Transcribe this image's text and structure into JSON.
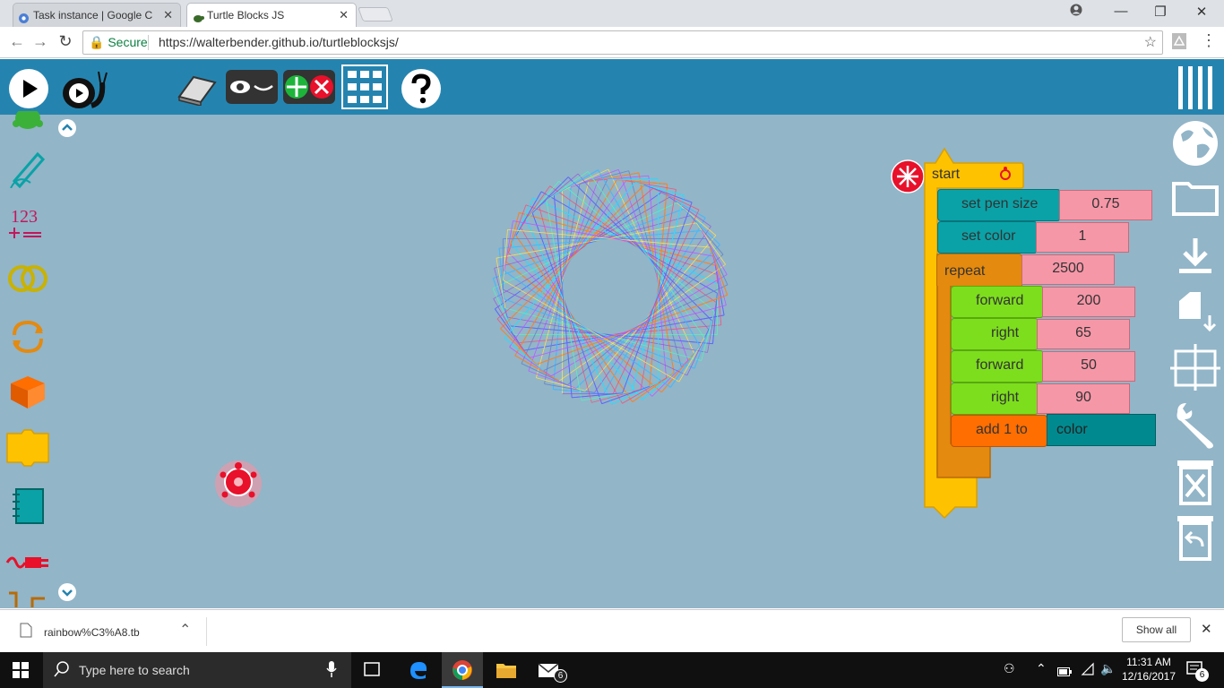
{
  "browser": {
    "tabs": [
      {
        "title": "Task instance | Google C",
        "close": "✕"
      },
      {
        "title": "Turtle Blocks JS",
        "close": "✕"
      }
    ],
    "secure_label": "Secure",
    "url": "https://walterbender.github.io/turtleblocksjs/"
  },
  "blocks": {
    "start": "start",
    "set_pen_size": {
      "label": "set pen size",
      "value": "0.75"
    },
    "set_color": {
      "label": "set color",
      "value": "1"
    },
    "repeat": {
      "label": "repeat",
      "value": "2500"
    },
    "forward1": {
      "label": "forward",
      "value": "200"
    },
    "right1": {
      "label": "right",
      "value": "65"
    },
    "forward2": {
      "label": "forward",
      "value": "50"
    },
    "right2": {
      "label": "right",
      "value": "90"
    },
    "add": {
      "label": "add 1 to",
      "value": "color"
    }
  },
  "palette": {
    "numbers_icon_text": "123"
  },
  "download_bar": {
    "filename": "rainbow%C3%A8.tb",
    "show_all": "Show all"
  },
  "taskbar": {
    "search_placeholder": "Type here to search",
    "time": "11:31 AM",
    "date": "12/16/2017",
    "mail_badge": "6",
    "notif_badge": "6"
  },
  "colors": {
    "toolbar": "#2584af",
    "workspace": "#92b5c8",
    "start_block": "#fec200",
    "pen_block": "#0aa2a7",
    "flow_block": "#e48a0f",
    "motion_block": "#7dde1d",
    "value_block": "#f697a8",
    "box_block": "#ff6e00"
  }
}
